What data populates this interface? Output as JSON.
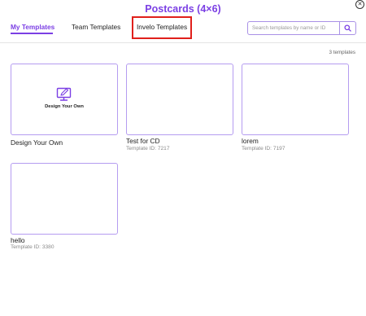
{
  "header": {
    "title": "Postcards (4×6)",
    "close_icon": "close-circle-icon"
  },
  "tabs": [
    {
      "label": "My Templates",
      "active": true
    },
    {
      "label": "Team Templates",
      "active": false
    },
    {
      "label": "Invelo Templates",
      "active": false
    }
  ],
  "search": {
    "placeholder": "Search templates by name or ID",
    "value": "",
    "icon": "search-icon"
  },
  "count_label": "3 templates",
  "design_card": {
    "inner_label": "Design Your Own",
    "name": "Design Your Own",
    "icon": "monitor-edit-icon"
  },
  "templates": [
    {
      "name": "Test for CD",
      "id_label": "Template ID: 7217"
    },
    {
      "name": "lorem",
      "id_label": "Template ID: 7197"
    },
    {
      "name": "hello",
      "id_label": "Template ID: 3380"
    }
  ],
  "colors": {
    "accent": "#7b3fe4",
    "card_border": "#b59cf0",
    "highlight": "#e0201b"
  }
}
